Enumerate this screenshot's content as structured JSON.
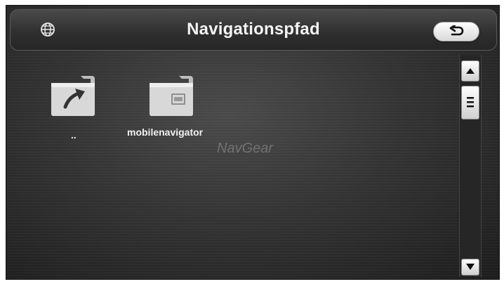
{
  "header": {
    "title": "Navigationspfad",
    "globe_icon": "globe-icon",
    "back_icon": "back-arrow-icon"
  },
  "folders": [
    {
      "label": "..",
      "icon": "folder-up-icon"
    },
    {
      "label": "mobilenavigator",
      "icon": "folder-icon"
    }
  ],
  "watermark": "NavGear",
  "scrollbar": {
    "up_icon": "scroll-up-icon",
    "thumb_icon": "scroll-thumb-icon",
    "down_icon": "scroll-down-icon"
  },
  "colors": {
    "background": "#333333",
    "header": "#3a3a3a",
    "text": "#f4f4f4",
    "button": "#e6e6e6"
  }
}
